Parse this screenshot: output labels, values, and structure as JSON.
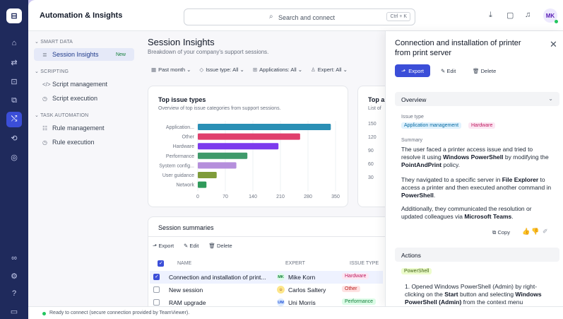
{
  "rail": {
    "logo": "⊟",
    "icons": [
      "home-icon",
      "transfer-icon",
      "scripting-icon",
      "devices-icon",
      "automation-icon",
      "integrations-icon",
      "settings-circle-icon",
      "connections-icon",
      "settings-icon",
      "help-icon",
      "panel-icon"
    ]
  },
  "topbar": {
    "title": "Automation & Insights",
    "search_placeholder": "Search and connect",
    "search_shortcut": "Ctrl + K",
    "avatar": "MK"
  },
  "sidenav": {
    "sections": [
      {
        "label": "SMART DATA",
        "items": [
          {
            "icon": "≣",
            "label": "Session Insights",
            "badge": "New",
            "active": true
          }
        ]
      },
      {
        "label": "SCRIPTING",
        "items": [
          {
            "icon": "</>",
            "label": "Script management"
          },
          {
            "icon": "◷",
            "label": "Script execution"
          }
        ]
      },
      {
        "label": "TASK AUTOMATION",
        "items": [
          {
            "icon": "☷",
            "label": "Rule management"
          },
          {
            "icon": "◷",
            "label": "Rule execution"
          }
        ]
      }
    ]
  },
  "main": {
    "title": "Session Insights",
    "subtitle": "Breakdown of your company's support sessions.",
    "filters": [
      "Past month",
      "Issue type: All",
      "Applications: All",
      "Expert: All"
    ]
  },
  "chart_data": [
    {
      "type": "bar",
      "orientation": "horizontal",
      "title": "Top issue types",
      "subtitle": "Overview of top issue categories from support sessions.",
      "categories": [
        "Application...",
        "Other",
        "Hardware",
        "Performance",
        "System config...",
        "User guidance",
        "Network"
      ],
      "values": [
        338,
        260,
        205,
        126,
        98,
        48,
        22
      ],
      "colors": [
        "#2a8fb5",
        "#e0406d",
        "#7c3aed",
        "#3f9a6a",
        "#b58fdc",
        "#7f9c3a",
        "#2f9a5a"
      ],
      "xticks": [
        0,
        70,
        140,
        210,
        280,
        350
      ],
      "xlim": [
        0,
        350
      ],
      "grid": true
    },
    {
      "type": "bar",
      "title": "Top ap",
      "subtitle": "List of",
      "yticks": [
        150,
        120,
        90,
        60,
        30
      ]
    }
  ],
  "summaries": {
    "title": "Session summaries",
    "actions": [
      "Export",
      "Edit",
      "Delete"
    ],
    "columns": [
      "NAME",
      "EXPERT",
      "ISSUE TYPE"
    ],
    "rows": [
      {
        "name": "Connection and installation of print...",
        "expert_initials": "MK",
        "expert": "Mike Korn",
        "issue": "Hardware",
        "checked": true
      },
      {
        "name": "New session",
        "expert_initials": "CS",
        "expert": "Carlos Saltery",
        "issue": "Other",
        "checked": false
      },
      {
        "name": "RAM upgrade",
        "expert_initials": "UM",
        "expert": "Uni Morris",
        "issue": "Performance",
        "checked": false
      }
    ]
  },
  "panel": {
    "title": "Connection and installation of printer from print server",
    "export": "Export",
    "edit": "Edit",
    "delete": "Delete",
    "overview": "Overview",
    "issue_type_label": "Issue type",
    "issue_chips": [
      "Application management",
      "Hardware"
    ],
    "summary_label": "Summary",
    "summary_p1": "The user faced a printer access issue and tried to resolve it using <b>Windows PowerShell</b> by modifying the <b>PointAndPrint</b> policy.",
    "summary_p2": "They navigated to a specific server in <b>File Explorer</b> to access a printer and then executed another command in <b>PowerShell</b>.",
    "summary_p3": "Additionally, they communicated the resolution or updated colleagues via <b>Microsoft Teams</b>.",
    "copy": "Copy",
    "actions_label": "Actions",
    "action_chip": "PowerShell",
    "action_step": "1. Opened Windows PowerShell (Admin) by right-clicking on the <b>Start</b> button and selecting <b>Windows PowerShell (Admin)</b> from the context menu"
  },
  "status": {
    "text": "Ready to connect (secure connection provided by TeamViewer)."
  },
  "colors": {
    "accent": "#3b4ed8",
    "rail": "#1f2a5c"
  }
}
